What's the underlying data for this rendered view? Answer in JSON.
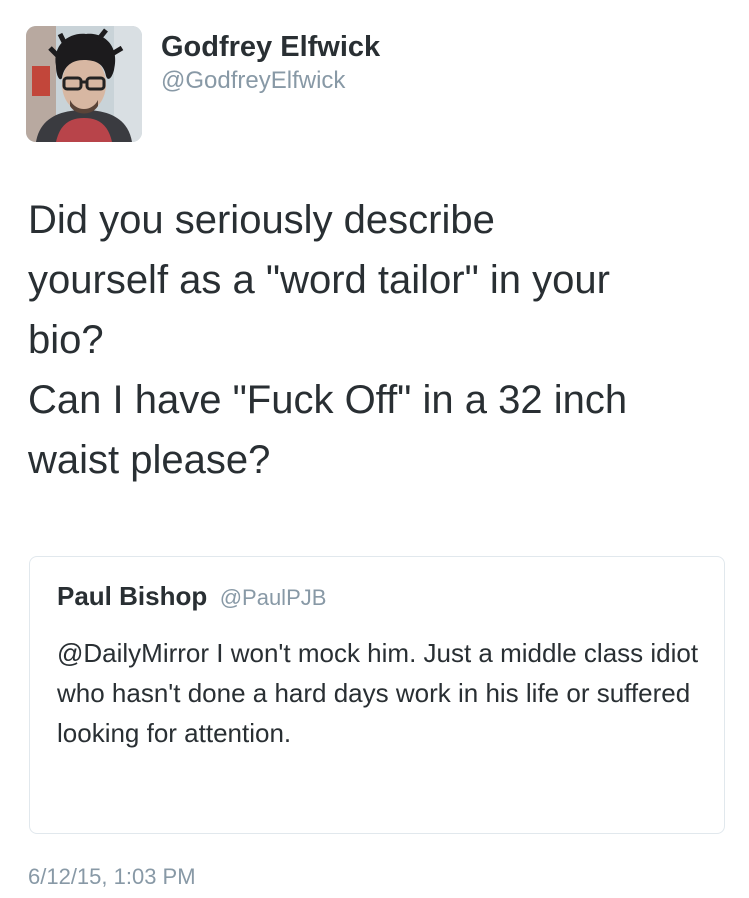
{
  "author": {
    "display_name": "Godfrey Elfwick",
    "handle": "@GodfreyElfwick",
    "avatar_icon": "profile-photo"
  },
  "tweet": {
    "text": "Did you seriously describe\nyourself as a \"word tailor\" in your\nbio?\nCan I have \"Fuck Off\" in a 32 inch\nwaist please?",
    "timestamp": "6/12/15, 1:03 PM"
  },
  "quoted_tweet": {
    "display_name": "Paul Bishop",
    "handle": "@PaulPJB",
    "text": "@DailyMirror I won't mock him. Just a middle class idiot who hasn't done a hard days work in his life or suffered looking for attention."
  },
  "colors": {
    "text": "#292f33",
    "secondary": "#8899a6",
    "border": "#e1e8ed",
    "background": "#ffffff"
  }
}
